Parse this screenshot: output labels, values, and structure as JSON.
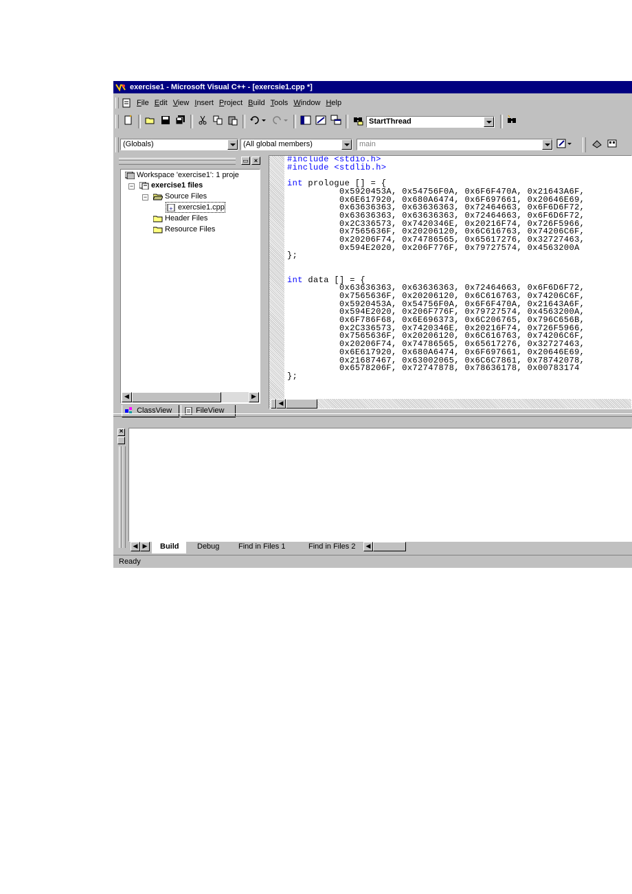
{
  "window": {
    "title": "exercise1 - Microsoft Visual C++ - [exercsie1.cpp *]",
    "colors": {
      "titlebar": "#000080",
      "face": "#c0c0c0",
      "keyword": "#0000ff"
    }
  },
  "menu": [
    "File",
    "Edit",
    "View",
    "Insert",
    "Project",
    "Build",
    "Tools",
    "Window",
    "Help"
  ],
  "toolbar": {
    "icons": [
      "new-file-icon",
      "open-icon",
      "save-icon",
      "save-all-icon",
      "cut-icon",
      "copy-icon",
      "paste-icon",
      "undo-icon",
      "redo-icon",
      "workspace-icon",
      "output-icon",
      "window-list-icon",
      "find-in-files-icon",
      "find-icon"
    ],
    "find_combo_value": "StartThread"
  },
  "wizardbar": {
    "class_combo": "(Globals)",
    "filter_combo": "(All global members)",
    "member_combo": "main"
  },
  "workspace": {
    "root": "Workspace 'exercise1': 1 proje",
    "project": "exercise1 files",
    "source_folder": "Source Files",
    "source_file": "exercsie1.cpp",
    "header_folder": "Header Files",
    "resource_folder": "Resource Files",
    "tabs": [
      "ClassView",
      "FileView"
    ]
  },
  "code": {
    "include1": "#include <stdio.h>",
    "include2": "#include <stdlib.h>",
    "prologue_decl": "prologue [] = {",
    "prologue_rows": [
      "0x5920453A, 0x54756F0A, 0x6F6F470A, 0x21643A6F,",
      "0x6E617920, 0x680A6474, 0x6F697661, 0x20646E69,",
      "0x63636363, 0x63636363, 0x72464663, 0x6F6D6F72,",
      "0x63636363, 0x63636363, 0x72464663, 0x6F6D6F72,",
      "0x2C336573, 0x7420346E, 0x20216F74, 0x726F5966,",
      "0x7565636F, 0x20206120, 0x6C616763, 0x74206C6F,",
      "0x20206F74, 0x74786565, 0x65617276, 0x32727463,",
      "0x594E2020, 0x206F776F, 0x79727574, 0x4563200A"
    ],
    "data_decl": "data [] = {",
    "data_rows": [
      "0x63636363, 0x63636363, 0x72464663, 0x6F6D6F72,",
      "0x7565636F, 0x20206120, 0x6C616763, 0x74206C6F,",
      "0x5920453A, 0x54756F0A, 0x6F6F470A, 0x21643A6F,",
      "0x594E2020, 0x206F776F, 0x79727574, 0x4563200A,",
      "0x6F786F68, 0x6E696373, 0x6C206765, 0x796C656B,",
      "0x2C336573, 0x7420346E, 0x20216F74, 0x726F5966,",
      "0x7565636F, 0x20206120, 0x6C616763, 0x74206C6F,",
      "0x20206F74, 0x74786565, 0x65617276, 0x32727463,",
      "0x6E617920, 0x680A6474, 0x6F697661, 0x20646E69,",
      "0x21687467, 0x63002065, 0x6C6C7861, 0x78742078,",
      "0x6578206F, 0x72747878, 0x78636178, 0x00783174"
    ],
    "keyword_int": "int",
    "close_brace": "};"
  },
  "output": {
    "tabs": [
      "Build",
      "Debug",
      "Find in Files 1",
      "Find in Files 2"
    ],
    "active_tab": "Build"
  },
  "status": {
    "text": "Ready"
  }
}
